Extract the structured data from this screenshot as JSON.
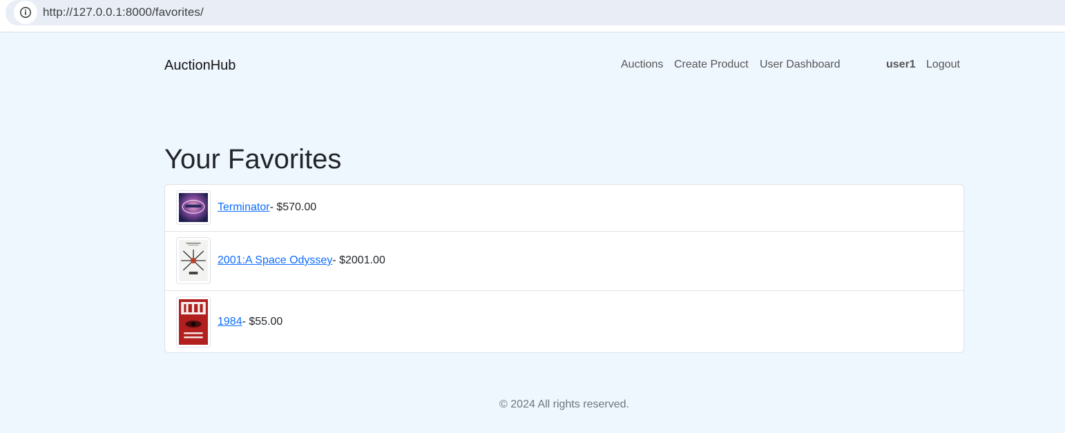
{
  "browser": {
    "url": "http://127.0.0.1:8000/favorites/",
    "info_icon": "info-icon"
  },
  "navbar": {
    "brand": "AuctionHub",
    "links": {
      "auctions": "Auctions",
      "create_product": "Create Product",
      "user_dashboard": "User Dashboard"
    },
    "username": "user1",
    "logout": "Logout"
  },
  "main": {
    "title": "Your Favorites",
    "favorites": [
      {
        "name": "Terminator",
        "price": "- $570.00",
        "thumbnail": "terminator-poster"
      },
      {
        "name": "2001:A Space Odyssey",
        "price": "- $2001.00",
        "thumbnail": "space-odyssey-poster"
      },
      {
        "name": "1984",
        "price": "- $55.00",
        "thumbnail": "1984-book-cover"
      }
    ]
  },
  "footer": {
    "text": "© 2024 All rights reserved."
  },
  "colors": {
    "page_background": "#eef6fe",
    "link": "#0d6efd",
    "muted": "#6c757d"
  }
}
